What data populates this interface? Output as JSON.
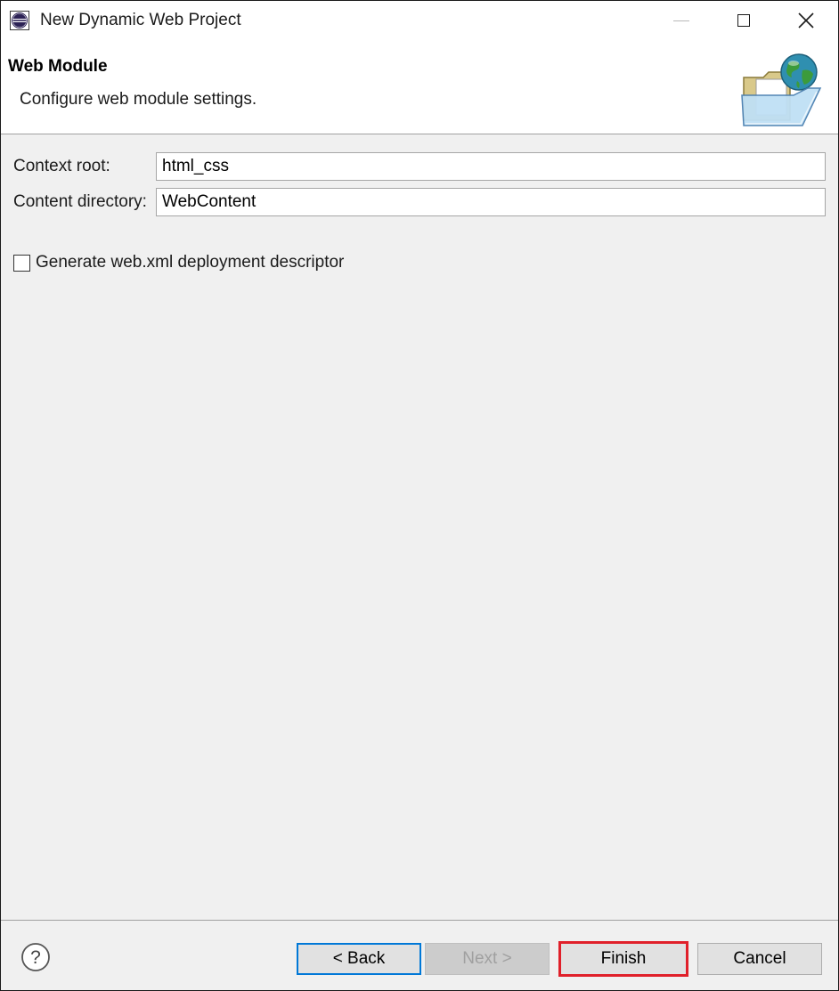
{
  "window": {
    "title": "New Dynamic Web Project",
    "controls": {
      "minimize": "minimize-icon",
      "maximize": "maximize-icon",
      "close": "close-icon",
      "close_glyph": "✕"
    }
  },
  "banner": {
    "title": "Web Module",
    "description": "Configure web module settings."
  },
  "form": {
    "context_root": {
      "label": "Context root:",
      "value": "html_css"
    },
    "content_directory": {
      "label": "Content directory:",
      "value": "WebContent"
    },
    "generate_descriptor": {
      "label": "Generate web.xml deployment descriptor",
      "checked": false
    }
  },
  "footer": {
    "help_glyph": "?",
    "back_label": "< Back",
    "next_label": "Next >",
    "finish_label": "Finish",
    "cancel_label": "Cancel"
  },
  "colors": {
    "dialog_background": "#f0f0f0",
    "focus_border": "#0078d7",
    "highlight_border": "#e0202a"
  }
}
